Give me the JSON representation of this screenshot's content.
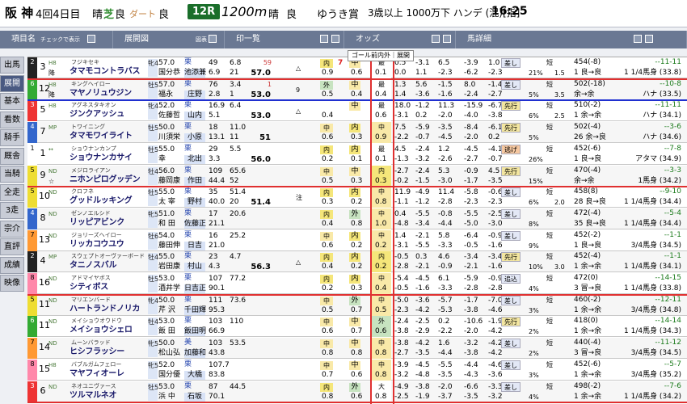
{
  "header": {
    "venue": "阪 神",
    "round": "4回4日目",
    "weather_label": "晴",
    "turf_label": "芝",
    "turf_cond": "良",
    "dirt_label": "ダート",
    "dirt_cond": "良",
    "race_no": "12R",
    "distance": "1200m",
    "weather2": "晴",
    "cond2": "良",
    "race_name": "ゆうき賞",
    "conditions": "3歳以上 1000万下 ハンデ (混)[指]",
    "start_time": "16:25"
  },
  "columns": [
    {
      "label": "項目名",
      "extra": "チェックで表示"
    },
    {
      "label": "展開図",
      "extra": "図表"
    },
    {
      "label": "印一覧",
      "extra": ""
    },
    {
      "label": "オッズ",
      "extra": ""
    },
    {
      "label": "馬詳細",
      "extra": ""
    }
  ],
  "sidebar": [
    "出馬",
    "展開",
    "基本",
    "看数",
    "騎手",
    "厩舎",
    "当騎",
    "全走",
    "3走",
    "宗介",
    "直評",
    "成績",
    "映像"
  ],
  "active_side": "展開",
  "tooltip": "ゴール前内外｜展開",
  "rows": [
    {
      "gate": "2",
      "num": "3",
      "mark": "降",
      "kind": "H8",
      "sire": "フジキセキ",
      "name": "タマモコントラバス",
      "cup": "牝4",
      "wt": "57.0",
      "jky": "国分恭",
      "trn_a": "栗",
      "trn_b": "池添兼",
      "o1": "49",
      "o2": "6.9",
      "o3": "6.8",
      "o4": "21",
      "best_a": "59",
      "best_b": "57.0",
      "ji_a": "内",
      "ji_b": "0.9",
      "p1": "7",
      "p2": "中",
      "p3": "0.6",
      "rank_a": "最",
      "rank_b": "0.1",
      "v1": "0.5",
      "v2": "-3.1",
      "v3": "6.5",
      "v4": "-3.9",
      "v5": "1.0",
      "vb1": "0.0",
      "vb2": "1.1",
      "vb3": "-2.3",
      "vb4": "-6.2",
      "vb5": "-2.3",
      "tag": "差し",
      "style": "短",
      "pct": "21%",
      "stat": "△",
      "stat2": "1.5",
      "w1": "454(-8)",
      "w2": "1 良→良",
      "lr1": "--11-11",
      "lr2": "1 1/4馬身 (33.8)"
    },
    {
      "gate": "6",
      "num": "12",
      "mark": "降",
      "kind": "H8",
      "sire": "キングヘイロー",
      "name": "マヤノリュウジン",
      "cup": "牡5",
      "wt": "57.0",
      "jky": "福永",
      "trn_a": "栗",
      "trn_b": "庄野",
      "o1": "76",
      "o2": "2.8",
      "o3": "3.4",
      "o4": "1",
      "best_a": "1",
      "best_b": "53.0",
      "ji_a": "外",
      "ji_b": "0.5",
      "p1": "",
      "p2": "中",
      "p3": "0.4",
      "rank_a": "最",
      "rank_b": "0.4",
      "v1": "1.3",
      "v2": "5.6",
      "v3": "-1.5",
      "v4": "8.0",
      "v5": "-1.4",
      "vb1": "1.4",
      "vb2": "-3.6",
      "vb3": "-1.6",
      "vb4": "-2.4",
      "vb5": "-2.7",
      "tag": "差し",
      "style": "短",
      "pct": "5%",
      "stat": "9",
      "stat2": "3.5",
      "w1": "502(-18)",
      "w2": "余→余",
      "lr1": "--10-8",
      "lr2": "ハナ (33.5)"
    },
    {
      "gate": "3",
      "num": "5",
      "mark": "",
      "kind": "H8",
      "sire": "アグネスタキオン",
      "name": "ジンクアッシュ",
      "cup": "牝4",
      "wt": "52.0",
      "jky": "佐藤哲",
      "trn_a": "栗",
      "trn_b": "山内",
      "o1": "16.9",
      "o2": "5.1",
      "o3": "6.4",
      "o4": "",
      "best_a": "",
      "best_b": "53.0",
      "ji_a": "",
      "ji_b": "0.4",
      "p1": "",
      "p2": "中",
      "p3": "",
      "rank_a": "最",
      "rank_b": "0.6",
      "v1": "18.0",
      "v2": "-1.2",
      "v3": "11.3",
      "v4": "-15.9",
      "v5": "-6.7",
      "vb1": "-3.1",
      "vb2": "0.2",
      "vb3": "-2.0",
      "vb4": "-4.0",
      "vb5": "-3.8",
      "tag": "先行",
      "style": "短",
      "pct": "6%",
      "stat": "△",
      "stat2": "2.5",
      "w1": "510(-2)",
      "w2": "1 余→余",
      "lr1": "--11-11",
      "lr2": "ハナ (34.1)"
    },
    {
      "gate": "4",
      "num": "7",
      "mark": "",
      "kind": "MP",
      "sire": "トワイニング",
      "name": "タマモワイライト",
      "cup": "牡5",
      "wt": "50.0",
      "jky": "川須栄",
      "trn_a": "栗",
      "trn_b": "小原",
      "o1": "18",
      "o2": "13.1",
      "o3": "11.0",
      "o4": "11",
      "best_a": "",
      "best_b": "51",
      "ji_a": "中",
      "ji_b": "0.6",
      "p1": "",
      "p2": "内",
      "p3": "0.3",
      "rank_a": "中",
      "rank_b": "0.9",
      "v1": "7.5",
      "v2": "-5.9",
      "v3": "-3.5",
      "v4": "-8.4",
      "v5": "-6.1",
      "vb1": "-2.2",
      "vb2": "-0.7",
      "vb3": "-4.5",
      "vb4": "-2.0",
      "vb5": "0.2",
      "tag": "先行",
      "style": "短",
      "pct": "5%",
      "stat": "",
      "stat2": "",
      "w1": "502(-4)",
      "w2": "26 余→良",
      "lr1": "--3-6",
      "lr2": "ハナ (34.6)"
    },
    {
      "gate": "1",
      "num": "1",
      "mark": "",
      "kind": "↔",
      "sire": "ショウナンカンプ",
      "name": "ショウナンカサイ",
      "cup": "牡5",
      "wt": "55.0",
      "jky": "幸",
      "trn_a": "栗",
      "trn_b": "北出",
      "o1": "29",
      "o2": "3.3",
      "o3": "5.5",
      "o4": "",
      "best_a": "",
      "best_b": "56.0",
      "ji_a": "内",
      "ji_b": "0.2",
      "p1": "",
      "p2": "内",
      "p3": "0.1",
      "rank_a": "最",
      "rank_b": "0.1",
      "v1": "4.5",
      "v2": "-2.4",
      "v3": "1.2",
      "v4": "-4.5",
      "v5": "-4.1",
      "vb1": "-1.3",
      "vb2": "-3.2",
      "vb3": "-2.6",
      "vb4": "-2.7",
      "vb5": "-0.7",
      "tag": "逃げ",
      "style": "短",
      "pct": "26%",
      "stat": "",
      "stat2": "",
      "w1": "452(-6)",
      "w2": "1 良→良",
      "lr1": "--7-8",
      "lr2": "アタマ (34.9)"
    },
    {
      "gate": "5",
      "num": "9",
      "mark": "☆",
      "kind": "ND",
      "sire": "メジロライアン",
      "name": "ニホンピログッデン",
      "cup": "牡4",
      "wt": "56.0",
      "jky": "藤岡康",
      "trn_a": "栗",
      "trn_b": "作田",
      "o1": "109",
      "o2": "44.4",
      "o3": "65.6",
      "o4": "52",
      "best_a": "",
      "best_b": "",
      "ji_a": "中",
      "ji_b": "0.5",
      "p1": "",
      "p2": "中",
      "p3": "0.3",
      "rank_a": "内",
      "rank_b": "0.3",
      "v1": "-2.7",
      "v2": "-2.4",
      "v3": "5.3",
      "v4": "-0.9",
      "v5": "4.5",
      "vb1": "-0.2",
      "vb2": "-1.5",
      "vb3": "-3.0",
      "vb4": "-1.7",
      "vb5": "-3.5",
      "tag": "先行",
      "style": "短",
      "pct": "15%",
      "stat": "",
      "stat2": "",
      "w1": "470(-4)",
      "w2": "余→余",
      "lr1": "--3-3",
      "lr2": "1馬身 (34.2)"
    },
    {
      "gate": "5",
      "num": "10",
      "mark": "",
      "kind": "ND",
      "sire": "クロフネ",
      "name": "グッドルッキング",
      "cup": "牡5",
      "wt": "55.0",
      "jky": "太 宰",
      "trn_a": "栗",
      "trn_b": "野村",
      "o1": "35",
      "o2": "40.0",
      "o3": "51.4",
      "o4": "20",
      "best_a": "",
      "best_b": "51.4",
      "ji_a": "内",
      "ji_b": "0.3",
      "p1": "",
      "p2": "内",
      "p3": "0.2",
      "rank_a": "中",
      "rank_b": "0.8",
      "v1": "11.9",
      "v2": "-4.9",
      "v3": "11.4",
      "v4": "-5.8",
      "v5": "-0.6",
      "vb1": "-1.1",
      "vb2": "-1.2",
      "vb3": "-2.8",
      "vb4": "-2.3",
      "vb5": "-2.3",
      "tag": "差し",
      "style": "短",
      "pct": "6%",
      "stat": "注",
      "stat2": "2.0",
      "w1": "458(8)",
      "w2": "28 良→良",
      "lr1": "--9-10",
      "lr2": "1 1/4馬身 (34.4)"
    },
    {
      "gate": "4",
      "num": "8",
      "mark": "",
      "kind": "ND",
      "sire": "ゼンノエルシド",
      "name": "リッピアビンク",
      "cup": "牝5",
      "wt": "51.0",
      "jky": "和 田",
      "trn_a": "栗",
      "trn_b": "佐藤正",
      "o1": "17",
      "o2": "21.1",
      "o3": "20.6",
      "o4": "",
      "best_a": "",
      "best_b": "",
      "ji_a": "内",
      "ji_b": "0.4",
      "p1": "",
      "p2": "外",
      "p3": "0.8",
      "rank_a": "中",
      "rank_b": "1.0",
      "v1": "0.4",
      "v2": "-5.5",
      "v3": "-0.8",
      "v4": "-5.5",
      "v5": "-2.5",
      "vb1": "-4.8",
      "vb2": "-3.4",
      "vb3": "-4.4",
      "vb4": "-5.0",
      "vb5": "-3.0",
      "tag": "差し",
      "style": "短",
      "pct": "8%",
      "stat": "",
      "stat2": "",
      "w1": "472(-4)",
      "w2": "35 良→良",
      "lr1": "--5-4",
      "lr2": "1 1/4馬身 (34.4)"
    },
    {
      "gate": "7",
      "num": "13",
      "mark": "",
      "kind": "ND",
      "sire": "ジョリーズヘイロー",
      "name": "リッカコウユウ",
      "cup": "牡6",
      "wt": "54.0",
      "jky": "藤田伸",
      "trn_a": "栗",
      "trn_b": "日吉",
      "o1": "16",
      "o2": "21.0",
      "o3": "25.2",
      "o4": "",
      "best_a": "",
      "best_b": "",
      "ji_a": "中",
      "ji_b": "0.6",
      "p1": "",
      "p2": "内",
      "p3": "0.2",
      "rank_a": "中",
      "rank_b": "0.2",
      "v1": "1.4",
      "v2": "-2.1",
      "v3": "5.8",
      "v4": "-6.4",
      "v5": "-0.9",
      "vb1": "-3.1",
      "vb2": "-5.5",
      "vb3": "-3.3",
      "vb4": "-0.5",
      "vb5": "-1.6",
      "tag": "差し",
      "style": "短",
      "pct": "9%",
      "stat": "",
      "stat2": "",
      "w1": "452(-2)",
      "w2": "1 良→良",
      "lr1": "--1-1",
      "lr2": "3/4馬身 (34.5)"
    },
    {
      "gate": "2",
      "num": "4",
      "mark": "",
      "kind": "MP",
      "sire": "スウェプトオーヴァーボード",
      "name": "タニノスバル",
      "cup": "牡4",
      "wt": "55.0",
      "jky": "岩田康",
      "trn_a": "栗",
      "trn_b": "村山",
      "o1": "23",
      "o2": "4.3",
      "o3": "4.7",
      "o4": "",
      "best_a": "",
      "best_b": "56.3",
      "ji_a": "内",
      "ji_b": "0.4",
      "p1": "",
      "p2": "内",
      "p3": "0.2",
      "rank_a": "内",
      "rank_b": "0.2",
      "v1": "-0.5",
      "v2": "0.3",
      "v3": "4.6",
      "v4": "-3.4",
      "v5": "-3.4",
      "vb1": "-2.8",
      "vb2": "-2.1",
      "vb3": "-0.9",
      "vb4": "-2.1",
      "vb5": "-1.6",
      "tag": "先行",
      "style": "短",
      "pct": "10%",
      "stat": "△",
      "stat2": "3.0",
      "w1": "452(-4)",
      "w2": "1 余→余",
      "lr1": "--1-1",
      "lr2": "1 1/4馬身 (34.1)"
    },
    {
      "gate": "8",
      "num": "16",
      "mark": "",
      "kind": "ND",
      "sire": "アドマイヤボス",
      "name": "シティボス",
      "cup": "牡5",
      "wt": "53.0",
      "jky": "酒井学",
      "trn_a": "栗",
      "trn_b": "日吉正",
      "o1": "107",
      "o2": "90.1",
      "o3": "77.2",
      "o4": "",
      "best_a": "",
      "best_b": "",
      "ji_a": "内",
      "ji_b": "0.2",
      "p1": "",
      "p2": "内",
      "p3": "0.3",
      "rank_a": "中",
      "rank_b": "0.4",
      "v1": "-5.4",
      "v2": "-4.5",
      "v3": "6.1",
      "v4": "-5.9",
      "v5": "-0.9",
      "vb1": "-0.5",
      "vb2": "-1.6",
      "vb3": "-3.3",
      "vb4": "-2.8",
      "vb5": "-2.8",
      "tag": "追込",
      "style": "短",
      "pct": "4%",
      "stat": "",
      "stat2": "",
      "w1": "472(0)",
      "w2": "3 冒→良",
      "lr1": "--14-15",
      "lr2": "1 1/4馬身 (33.8)"
    },
    {
      "gate": "5",
      "num": "11",
      "mark": "",
      "kind": "ND",
      "sire": "マリエンバード",
      "name": "ハートランドノリカ",
      "cup": "牝4",
      "wt": "50.0",
      "jky": "芹 沢",
      "trn_a": "栗",
      "trn_b": "千田輝",
      "o1": "111",
      "o2": "95.3",
      "o3": "73.6",
      "o4": "",
      "best_a": "",
      "best_b": "",
      "ji_a": "中",
      "ji_b": "0.5",
      "p1": "",
      "p2": "外",
      "p3": "0.7",
      "rank_a": "中",
      "rank_b": "0.5",
      "v1": "-5.0",
      "v2": "-3.6",
      "v3": "-5.7",
      "v4": "-1.7",
      "v5": "-7.0",
      "vb1": "-2.3",
      "vb2": "-4.2",
      "vb3": "-5.3",
      "vb4": "-3.8",
      "vb5": "-4.6",
      "tag": "差し",
      "style": "短",
      "pct": "3%",
      "stat": "",
      "stat2": "",
      "w1": "460(-2)",
      "w2": "1 余→余",
      "lr1": "--12-11",
      "lr2": "3/4馬身 (34.8)"
    },
    {
      "gate": "6",
      "num": "11",
      "mark": "",
      "kind": "ND",
      "sire": "メイショウオウドウ",
      "name": "メイショウシェロ",
      "cup": "牡4",
      "wt": "53.0",
      "jky": "飯 田",
      "trn_a": "栗",
      "trn_b": "飯田明",
      "o1": "103",
      "o2": "66.9",
      "o3": "110",
      "o4": "",
      "best_a": "",
      "best_b": "",
      "ji_a": "中",
      "ji_b": "0.6",
      "p1": "",
      "p2": "中",
      "p3": "0.7",
      "rank_a": "外",
      "rank_b": "0.6",
      "v1": "-2.4",
      "v2": "-2.5",
      "v3": "0.2",
      "v4": "-10.6",
      "v5": "-1.9",
      "vb1": "-3.8",
      "vb2": "-2.9",
      "vb3": "-2.2",
      "vb4": "-2.0",
      "vb5": "-4.2",
      "tag": "先行",
      "style": "短",
      "pct": "2%",
      "stat": "",
      "stat2": "",
      "w1": "418(0)",
      "w2": "1 余→余",
      "lr1": "--14-14",
      "lr2": "1 1/4馬身 (34.3)"
    },
    {
      "gate": "7",
      "num": "14",
      "mark": "",
      "kind": "ND",
      "sire": "ムーンバラッド",
      "name": "ヒシフラッシー",
      "cup": "牝5",
      "wt": "50.0",
      "jky": "松山弘",
      "trn_a": "美",
      "trn_b": "加藤和",
      "o1": "103",
      "o2": "43.8",
      "o3": "53.5",
      "o4": "",
      "best_a": "",
      "best_b": "",
      "ji_a": "中",
      "ji_b": "0.8",
      "p1": "",
      "p2": "中",
      "p3": "0.8",
      "rank_a": "中",
      "rank_b": "0.8",
      "v1": "-3.8",
      "v2": "-4.2",
      "v3": "1.6",
      "v4": "-3.2",
      "v5": "-4.2",
      "vb1": "-2.7",
      "vb2": "-3.5",
      "vb3": "-4.4",
      "vb4": "-3.8",
      "vb5": "-4.2",
      "tag": "差し",
      "style": "短",
      "pct": "2%",
      "stat": "",
      "stat2": "",
      "w1": "440(-4)",
      "w2": "3 冒→良",
      "lr1": "--11-12",
      "lr2": "3/4馬身 (34.5)"
    },
    {
      "gate": "8",
      "num": "15",
      "mark": "",
      "kind": "H8",
      "sire": "バブルガムフェロー",
      "name": "マヤフィオーレ",
      "cup": "牝5",
      "wt": "52.0",
      "jky": "国分優",
      "trn_a": "栗",
      "trn_b": "大橋",
      "o1": "107.7",
      "o2": "83.8",
      "o3": "",
      "o4": "",
      "best_a": "",
      "best_b": "",
      "ji_a": "中",
      "ji_b": "0.7",
      "p1": "",
      "p2": "中",
      "p3": "0.6",
      "rank_a": "中",
      "rank_b": "0.8",
      "v1": "-3.9",
      "v2": "-4.5",
      "v3": "-5.5",
      "v4": "-4.4",
      "v5": "-4.6",
      "vb1": "-3.2",
      "vb2": "-4.8",
      "vb3": "-3.5",
      "vb4": "-4.3",
      "vb5": "-3.6",
      "tag": "差し",
      "style": "短",
      "pct": "3%",
      "stat": "",
      "stat2": "",
      "w1": "452(-6)",
      "w2": "1 余→余",
      "lr1": "--5-7",
      "lr2": "3/4馬身 (35.2)"
    },
    {
      "gate": "3",
      "num": "6",
      "mark": "",
      "kind": "ND",
      "sire": "ネオユニヴァース",
      "name": "ツルマルネオ",
      "cup": "牡5",
      "wt": "53.0",
      "jky": "浜 中",
      "trn_a": "栗",
      "trn_b": "石坂",
      "o1": "87",
      "o2": "70.1",
      "o3": "44.5",
      "o4": "",
      "best_a": "",
      "best_b": "",
      "ji_a": "内",
      "ji_b": "0.8",
      "p1": "",
      "p2": "外",
      "p3": "0.6",
      "rank_a": "大",
      "rank_b": "0.8",
      "v1": "-4.9",
      "v2": "-3.8",
      "v3": "-2.0",
      "v4": "-6.6",
      "v5": "-3.3",
      "vb1": "-2.5",
      "vb2": "-1.9",
      "vb3": "-3.7",
      "vb4": "-3.5",
      "vb5": "-3.2",
      "tag": "差し",
      "style": "短",
      "pct": "4%",
      "stat": "",
      "stat2": "",
      "w1": "498(-2)",
      "w2": "1 余→余",
      "lr1": "--7-6",
      "lr2": "1 1/4馬身 (34.2)"
    }
  ],
  "colors": {
    "header_bar": "#6a7893",
    "sidebar_active": "#4a5a82",
    "highlight_red": "#e03030",
    "highlight_blue": "#2030d0"
  }
}
